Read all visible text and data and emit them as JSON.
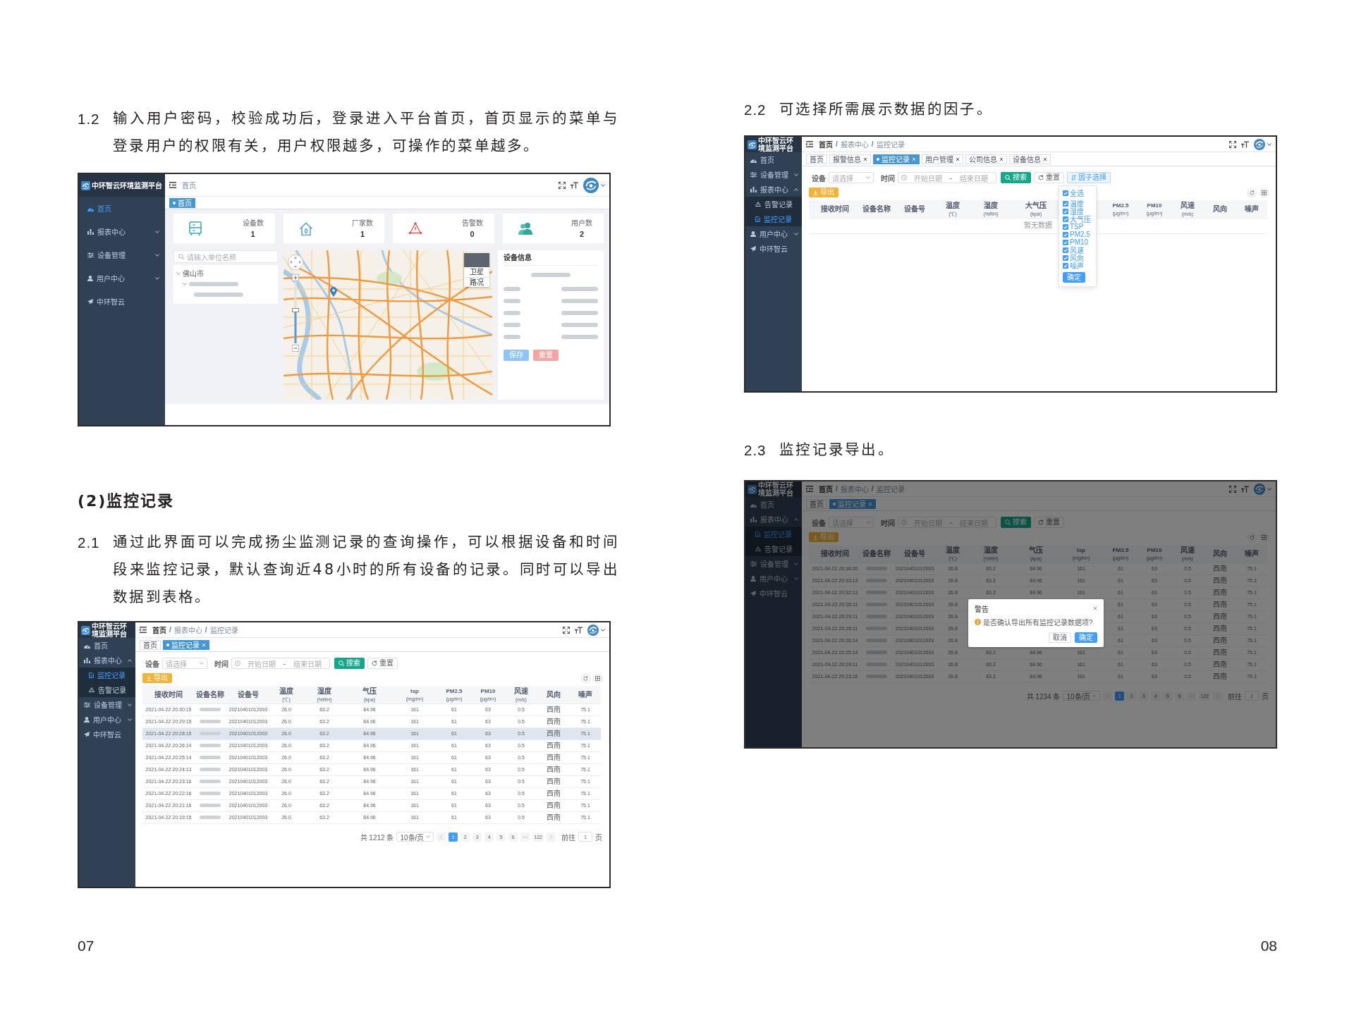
{
  "pages": [
    {
      "number": "07",
      "blocks": [
        {
          "kind": "step",
          "number": "1.2",
          "text": "输入用户密码，校验成功后，登录进入平台首页，首页显示的菜单与登录用户的权限有关，用户权限越多，可操作的菜单越多。"
        },
        {
          "kind": "screenshot",
          "screen": {
            "kind": "dashboard",
            "brand": "中环智云环境监测平台",
            "menu": [
              {
                "kind": "home",
                "label": "首页",
                "selected": true
              },
              {
                "kind": "reports",
                "label": "报表中心",
                "selected": false,
                "expanded": false
              },
              {
                "kind": "devices",
                "label": "设备管理",
                "selected": false,
                "expanded": false
              },
              {
                "kind": "users",
                "label": "用户中心",
                "selected": false,
                "expanded": false
              },
              {
                "kind": "about",
                "label": "中环智云",
                "selected": false
              }
            ],
            "breadcrumb": [
              {
                "label": "首页"
              }
            ],
            "tags": [
              {
                "label": "首页",
                "selected": true,
                "closable": false
              }
            ],
            "stats": [
              {
                "kind": "devices",
                "label": "设备数",
                "value": "1"
              },
              {
                "kind": "vendors",
                "label": "厂家数",
                "value": "1"
              },
              {
                "kind": "alarms",
                "label": "告警数",
                "value": "0"
              },
              {
                "kind": "users",
                "label": "用户数",
                "value": "2"
              }
            ],
            "tree": {
              "placeholder": "请输入单位名称",
              "nodes": [
                {
                  "kind": "text",
                  "label": "佛山市",
                  "expanded": true,
                  "children": [
                    {
                      "kind": "redacted",
                      "expanded": true,
                      "children": [
                        {
                          "kind": "redacted"
                        }
                      ]
                    }
                  ]
                }
              ]
            },
            "map": {
              "layers": [
                {
                  "label": "卫星"
                },
                {
                  "label": "路况"
                }
              ]
            },
            "info": {
              "title": "设备信息",
              "heading": {
                "kind": "redacted"
              },
              "fields": [
                {
                  "kind": "redacted"
                },
                {
                  "kind": "redacted"
                },
                {
                  "kind": "redacted"
                },
                {
                  "kind": "redacted"
                },
                {
                  "kind": "redacted"
                }
              ],
              "buttons": [
                {
                  "kind": "save",
                  "label": "保存"
                },
                {
                  "kind": "reset_soft",
                  "label": "重置"
                }
              ]
            }
          }
        },
        {
          "kind": "heading",
          "text": "(2)监控记录"
        },
        {
          "kind": "step",
          "number": "2.1",
          "text": "通过此界面可以完成扬尘监测记录的查询操作，可以根据设备和时间段来监控记录，默认查询近48小时的所有设备的记录。同时可以导出数据到表格。"
        },
        {
          "kind": "screenshot",
          "screen": {
            "kind": "records",
            "brand": "中环智云环境监测平台",
            "menu": [
              {
                "kind": "home",
                "label": "首页",
                "selected": false
              },
              {
                "kind": "reports",
                "label": "报表中心",
                "selected": false,
                "expanded": true,
                "children": [
                  {
                    "kind": "monitor",
                    "label": "监控记录",
                    "selected": true
                  },
                  {
                    "kind": "alarm",
                    "label": "告警记录",
                    "selected": false
                  }
                ]
              },
              {
                "kind": "devices",
                "label": "设备管理",
                "selected": false,
                "expanded": false
              },
              {
                "kind": "users",
                "label": "用户中心",
                "selected": false,
                "expanded": false
              },
              {
                "kind": "about",
                "label": "中环智云",
                "selected": false
              }
            ],
            "breadcrumb": [
              {
                "label": "首页"
              },
              {
                "separator": "/",
                "label": "报表中心"
              },
              {
                "separator": "/",
                "label": "监控记录"
              }
            ],
            "tags": [
              {
                "label": "首页",
                "selected": false,
                "closable": false
              },
              {
                "label": "监控记录",
                "selected": true,
                "closable": true
              }
            ],
            "filters": {
              "device_label": "设备",
              "device_placeholder": "请选择",
              "time_label": "时间",
              "start_placeholder": "开始日期",
              "range_separator": "-",
              "end_placeholder": "结束日期"
            },
            "filter_buttons": [
              {
                "kind": "search",
                "label": "搜索"
              },
              {
                "kind": "reset",
                "label": "重置"
              }
            ],
            "export_button": "导出",
            "table": {
              "columns": [
                {
                  "label": "接收时间"
                },
                {
                  "label": "设备名称"
                },
                {
                  "label": "设备号"
                },
                {
                  "label": "温度",
                  "unit": "(℃)"
                },
                {
                  "label": "湿度",
                  "unit": "(%RH)"
                },
                {
                  "label": "气压",
                  "unit": "(kpa)"
                },
                {
                  "label": "tsp",
                  "unit": "(mg/m³)"
                },
                {
                  "label": "PM2.5",
                  "unit": "(μg/m³)"
                },
                {
                  "label": "PM10",
                  "unit": "(μg/m³)"
                },
                {
                  "label": "风速",
                  "unit": "(m/s)"
                },
                {
                  "label": "风向"
                },
                {
                  "label": "噪声"
                }
              ],
              "rows": [
                {
                  "highlighted": false,
                  "cells": [
                    "2021-04-22 20:30:15",
                    {
                      "kind": "redacted"
                    },
                    "20210401012003",
                    "26.0",
                    "63.2",
                    "84.96",
                    "161",
                    "61",
                    "63",
                    "0.5",
                    "西南",
                    "75.1"
                  ]
                },
                {
                  "highlighted": false,
                  "cells": [
                    "2021-04-22 20:29:15",
                    {
                      "kind": "redacted"
                    },
                    "20210401012003",
                    "26.0",
                    "63.2",
                    "84.96",
                    "161",
                    "61",
                    "63",
                    "0.5",
                    "西南",
                    "75.1"
                  ]
                },
                {
                  "highlighted": true,
                  "cells": [
                    "2021-04-22 20:28:15",
                    {
                      "kind": "redacted"
                    },
                    "20210401012003",
                    "26.0",
                    "63.2",
                    "84.96",
                    "161",
                    "61",
                    "63",
                    "0.5",
                    "西南",
                    "75.1"
                  ]
                },
                {
                  "highlighted": false,
                  "cells": [
                    "2021-04-22 20:26:14",
                    {
                      "kind": "redacted"
                    },
                    "20210401012003",
                    "26.0",
                    "63.2",
                    "84.96",
                    "161",
                    "61",
                    "63",
                    "0.5",
                    "西南",
                    "75.1"
                  ]
                },
                {
                  "highlighted": false,
                  "cells": [
                    "2021-04-22 20:25:14",
                    {
                      "kind": "redacted"
                    },
                    "20210401012003",
                    "26.0",
                    "63.2",
                    "84.96",
                    "161",
                    "61",
                    "63",
                    "0.5",
                    "西南",
                    "75.1"
                  ]
                },
                {
                  "highlighted": false,
                  "cells": [
                    "2021-04-22 20:24:13",
                    {
                      "kind": "redacted"
                    },
                    "20210401012003",
                    "26.0",
                    "63.2",
                    "84.96",
                    "161",
                    "61",
                    "63",
                    "0.5",
                    "西南",
                    "75.1"
                  ]
                },
                {
                  "highlighted": false,
                  "cells": [
                    "2021-04-22 20:23:16",
                    {
                      "kind": "redacted"
                    },
                    "20210401012003",
                    "26.0",
                    "63.2",
                    "84.96",
                    "161",
                    "61",
                    "63",
                    "0.5",
                    "西南",
                    "75.1"
                  ]
                },
                {
                  "highlighted": false,
                  "cells": [
                    "2021-04-22 20:22:16",
                    {
                      "kind": "redacted"
                    },
                    "20210401012003",
                    "26.0",
                    "63.2",
                    "84.96",
                    "161",
                    "61",
                    "63",
                    "0.5",
                    "西南",
                    "75.1"
                  ]
                },
                {
                  "highlighted": false,
                  "cells": [
                    "2021-04-22 20:21:16",
                    {
                      "kind": "redacted"
                    },
                    "20210401012003",
                    "26.0",
                    "63.2",
                    "84.96",
                    "161",
                    "61",
                    "63",
                    "0.5",
                    "西南",
                    "75.1"
                  ]
                },
                {
                  "highlighted": false,
                  "cells": [
                    "2021-04-22 20:19:15",
                    {
                      "kind": "redacted"
                    },
                    "20210401012003",
                    "26.0",
                    "63.2",
                    "84.96",
                    "161",
                    "61",
                    "63",
                    "0.5",
                    "西南",
                    "75.1"
                  ]
                }
              ]
            },
            "pagination": {
              "total": "共 1212 条",
              "page_size": "10条/页",
              "pages": [
                {
                  "label": "1",
                  "selected": true
                },
                {
                  "label": "2",
                  "selected": false
                },
                {
                  "label": "3",
                  "selected": false
                },
                {
                  "label": "4",
                  "selected": false
                },
                {
                  "label": "5",
                  "selected": false
                },
                {
                  "label": "6",
                  "selected": false
                },
                {
                  "label": "···",
                  "selected": false
                },
                {
                  "label": "122",
                  "selected": false
                }
              ],
              "goto_label": "前往",
              "goto_value": "1",
              "goto_suffix": "页"
            }
          }
        }
      ]
    },
    {
      "number": "08",
      "blocks": [
        {
          "kind": "step",
          "number": "2.2",
          "text": "可选择所需展示数据的因子。"
        },
        {
          "kind": "screenshot",
          "screen": {
            "kind": "records",
            "brand": "中环智云环境监测平台",
            "menu": [
              {
                "kind": "home",
                "label": "首页",
                "selected": false
              },
              {
                "kind": "devices",
                "label": "设备管理",
                "selected": false,
                "expanded": false
              },
              {
                "kind": "reports",
                "label": "报表中心",
                "selected": false,
                "expanded": true,
                "children": [
                  {
                    "kind": "alarm",
                    "label": "告警记录",
                    "selected": false
                  },
                  {
                    "kind": "monitor",
                    "label": "监控记录",
                    "selected": true
                  }
                ]
              },
              {
                "kind": "users",
                "label": "用户中心",
                "selected": false,
                "expanded": false
              },
              {
                "kind": "about",
                "label": "中环智云",
                "selected": false
              }
            ],
            "breadcrumb": [
              {
                "label": "首页"
              },
              {
                "separator": "/",
                "label": "报表中心"
              },
              {
                "separator": "/",
                "label": "监控记录"
              }
            ],
            "tags": [
              {
                "label": "首页",
                "selected": false,
                "closable": false
              },
              {
                "label": "报警信息",
                "selected": false,
                "closable": true
              },
              {
                "label": "监控记录",
                "selected": true,
                "closable": true
              },
              {
                "label": "用户管理",
                "selected": false,
                "closable": true
              },
              {
                "label": "公司信息",
                "selected": false,
                "closable": true
              },
              {
                "label": "设备信息",
                "selected": false,
                "closable": true
              }
            ],
            "filters": {
              "device_label": "设备",
              "device_placeholder": "请选择",
              "time_label": "时间",
              "start_placeholder": "开始日期",
              "range_separator": "-",
              "end_placeholder": "结束日期"
            },
            "filter_buttons": [
              {
                "kind": "search",
                "label": "搜索"
              },
              {
                "kind": "reset",
                "label": "重置"
              },
              {
                "kind": "factor",
                "label": "因子选择"
              }
            ],
            "export_button": "导出",
            "factor_menu": {
              "items": [
                {
                  "label": "全选",
                  "checked": true
                },
                {
                  "label": "温度",
                  "checked": true
                },
                {
                  "label": "湿度",
                  "checked": true
                },
                {
                  "label": "大气压",
                  "checked": true
                },
                {
                  "label": "TSP",
                  "checked": true
                },
                {
                  "label": "PM2.5",
                  "checked": true
                },
                {
                  "label": "PM10",
                  "checked": true
                },
                {
                  "label": "风速",
                  "checked": true
                },
                {
                  "label": "风向",
                  "checked": true
                },
                {
                  "label": "噪声",
                  "checked": true
                }
              ],
              "confirm": "确定"
            },
            "table": {
              "columns": [
                {
                  "label": "接收时间"
                },
                {
                  "label": "设备名称"
                },
                {
                  "label": "设备号"
                },
                {
                  "label": "温度",
                  "unit": "(℃)"
                },
                {
                  "label": "湿度",
                  "unit": "(%RH)"
                },
                {
                  "label": "大气压",
                  "unit": "(kpa)"
                },
                null,
                {
                  "label": "PM2.5",
                  "unit": "(μg/m³)"
                },
                {
                  "label": "PM10",
                  "unit": "(μg/m³)"
                },
                {
                  "label": "风速",
                  "unit": "(m/s)"
                },
                {
                  "label": "风向"
                },
                {
                  "label": "噪声"
                }
              ],
              "empty_text": "暂无数据"
            }
          }
        },
        {
          "kind": "step",
          "number": "2.3",
          "text": "监控记录导出。"
        },
        {
          "kind": "screenshot",
          "screen": {
            "kind": "records",
            "brand": "中环智云环境监测平台",
            "menu": [
              {
                "kind": "home",
                "label": "首页",
                "selected": false
              },
              {
                "kind": "reports",
                "label": "报表中心",
                "selected": false,
                "expanded": true,
                "children": [
                  {
                    "kind": "monitor",
                    "label": "监控记录",
                    "selected": true
                  },
                  {
                    "kind": "alarm",
                    "label": "告警记录",
                    "selected": false
                  }
                ]
              },
              {
                "kind": "devices",
                "label": "设备管理",
                "selected": false,
                "expanded": false
              },
              {
                "kind": "users",
                "label": "用户中心",
                "selected": false,
                "expanded": false
              },
              {
                "kind": "about",
                "label": "中环智云",
                "selected": false
              }
            ],
            "breadcrumb": [
              {
                "label": "首页"
              },
              {
                "separator": "/",
                "label": "报表中心"
              },
              {
                "separator": "/",
                "label": "监控记录"
              }
            ],
            "tags": [
              {
                "label": "首页",
                "selected": false,
                "closable": false
              },
              {
                "label": "监控记录",
                "selected": true,
                "closable": true
              }
            ],
            "filters": {
              "device_label": "设备",
              "device_placeholder": "请选择",
              "time_label": "时间",
              "start_placeholder": "开始日期",
              "range_separator": "-",
              "end_placeholder": "结束日期"
            },
            "filter_buttons": [
              {
                "kind": "search",
                "label": "搜索"
              },
              {
                "kind": "reset",
                "label": "重置"
              }
            ],
            "export_button": "导出",
            "table": {
              "columns": [
                {
                  "label": "接收时间"
                },
                {
                  "label": "设备名称"
                },
                {
                  "label": "设备号"
                },
                {
                  "label": "温度",
                  "unit": "(℃)"
                },
                {
                  "label": "湿度",
                  "unit": "(%RH)"
                },
                {
                  "label": "气压",
                  "unit": "(kpa)"
                },
                {
                  "label": "tsp",
                  "unit": "(mg/m³)"
                },
                {
                  "label": "PM2.5",
                  "unit": "(μg/m³)"
                },
                {
                  "label": "PM10",
                  "unit": "(μg/m³)"
                },
                {
                  "label": "风速",
                  "unit": "(m/s)"
                },
                {
                  "label": "风向"
                },
                {
                  "label": "噪声"
                }
              ],
              "rows": [
                {
                  "cells": [
                    "2021-04-22 20:36:20",
                    {
                      "kind": "redacted"
                    },
                    "20210401012003",
                    "26.8",
                    "63.2",
                    "84.96",
                    "161",
                    "61",
                    "63",
                    "0.5",
                    "西南",
                    "75.1"
                  ]
                },
                {
                  "cells": [
                    "2021-04-22 20:33:13",
                    {
                      "kind": "redacted"
                    },
                    "20210401012003",
                    "26.8",
                    "63.2",
                    "84.96",
                    "161",
                    "61",
                    "63",
                    "0.5",
                    "西南",
                    "75.1"
                  ]
                },
                {
                  "cells": [
                    "2021-04-22 20:32:13",
                    {
                      "kind": "redacted"
                    },
                    "20210401012003",
                    "26.8",
                    "63.2",
                    "84.96",
                    "161",
                    "61",
                    "63",
                    "0.5",
                    "西南",
                    "75.1"
                  ]
                },
                {
                  "cells": [
                    "2021-04-22 20:30:11",
                    {
                      "kind": "redacted"
                    },
                    "20210401012003",
                    "26.8",
                    null,
                    null,
                    null,
                    "61",
                    "63",
                    "0.5",
                    "西南",
                    "75.1"
                  ]
                },
                {
                  "cells": [
                    "2021-04-22 20:29:11",
                    {
                      "kind": "redacted"
                    },
                    "20210401012003",
                    "26.8",
                    null,
                    null,
                    null,
                    "61",
                    "63",
                    "0.5",
                    "西南",
                    "75.1"
                  ]
                },
                {
                  "cells": [
                    "2021-04-22 20:28:11",
                    {
                      "kind": "redacted"
                    },
                    "20210401012003",
                    "26.8",
                    null,
                    null,
                    null,
                    "61",
                    "63",
                    "0.5",
                    "西南",
                    "75.1"
                  ]
                },
                {
                  "cells": [
                    "2021-04-22 20:26:14",
                    {
                      "kind": "redacted"
                    },
                    "20210401012003",
                    "26.8",
                    null,
                    null,
                    null,
                    "61",
                    "63",
                    "0.5",
                    "西南",
                    "75.1"
                  ]
                },
                {
                  "cells": [
                    "2021-04-22 20:25:14",
                    {
                      "kind": "redacted"
                    },
                    "20210401012003",
                    "26.8",
                    "63.2",
                    "84.96",
                    "161",
                    "61",
                    "63",
                    "0.5",
                    "西南",
                    "75.1"
                  ]
                },
                {
                  "cells": [
                    "2021-04-22 20:24:11",
                    {
                      "kind": "redacted"
                    },
                    "20210401012003",
                    "26.8",
                    "63.2",
                    "84.96",
                    "161",
                    "61",
                    "63",
                    "0.5",
                    "西南",
                    "75.1"
                  ]
                },
                {
                  "cells": [
                    "2021-04-22 20:23:16",
                    {
                      "kind": "redacted"
                    },
                    "20210401012003",
                    "26.8",
                    "63.2",
                    "84.96",
                    "161",
                    "61",
                    "63",
                    "0.5",
                    "西南",
                    "75.1"
                  ]
                }
              ]
            },
            "pagination": {
              "total": "共 1234 条",
              "page_size": "10条/页",
              "pages": [
                {
                  "label": "1",
                  "selected": true
                },
                {
                  "label": "2",
                  "selected": false
                },
                {
                  "label": "3",
                  "selected": false
                },
                {
                  "label": "4",
                  "selected": false
                },
                {
                  "label": "5",
                  "selected": false
                },
                {
                  "label": "6",
                  "selected": false
                },
                {
                  "label": "···",
                  "selected": false
                },
                {
                  "label": "122",
                  "selected": false
                }
              ],
              "goto_label": "前往",
              "goto_value": "1",
              "goto_suffix": "页"
            },
            "dialog": {
              "title": "警告",
              "message": "是否确认导出所有监控记录数据项?",
              "buttons": [
                {
                  "kind": "cancel",
                  "label": "取消"
                },
                {
                  "kind": "confirm",
                  "label": "确定"
                }
              ]
            }
          }
        }
      ]
    }
  ]
}
